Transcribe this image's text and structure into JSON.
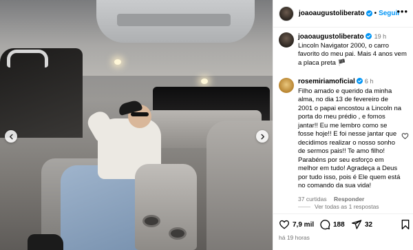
{
  "post": {
    "author": "joaoaugustoliberato",
    "follow_label": "Seguir",
    "separator": "•",
    "more_label": "•••",
    "caption_time": "19 h",
    "caption_text": "Lincoln Navigator 2000, o carro favorito do meu pai. Mais 4 anos vem a placa preta 🏴"
  },
  "comment": {
    "author": "rosemiriamoficial",
    "time": "6 h",
    "text": "Filho amado e querido da minha alma, no dia 13 de fevereiro de 2001 o papai encostou a Lincoln na porta do meu prédio , e fomos jantar!! Eu me lembro como se fosse hoje!! E foi nesse jantar que decidimos realizar o nosso sonho de sermos pais!! Te amo filho! Parabéns por seu esforço em melhor em tudo! Agradeça a Deus por tudo isso, pois é Ele quem está no comando da sua vida!",
    "likes_label": "37 curtidas",
    "reply_label": "Responder",
    "view_replies": "Ver todas as 1 respostas"
  },
  "actions": {
    "likes": "7,9 mil",
    "comments": "188",
    "shares": "32",
    "post_time": "há 19 horas"
  },
  "colors": {
    "accent": "#0095f6",
    "verified": "#0095f6",
    "muted": "#737373"
  }
}
